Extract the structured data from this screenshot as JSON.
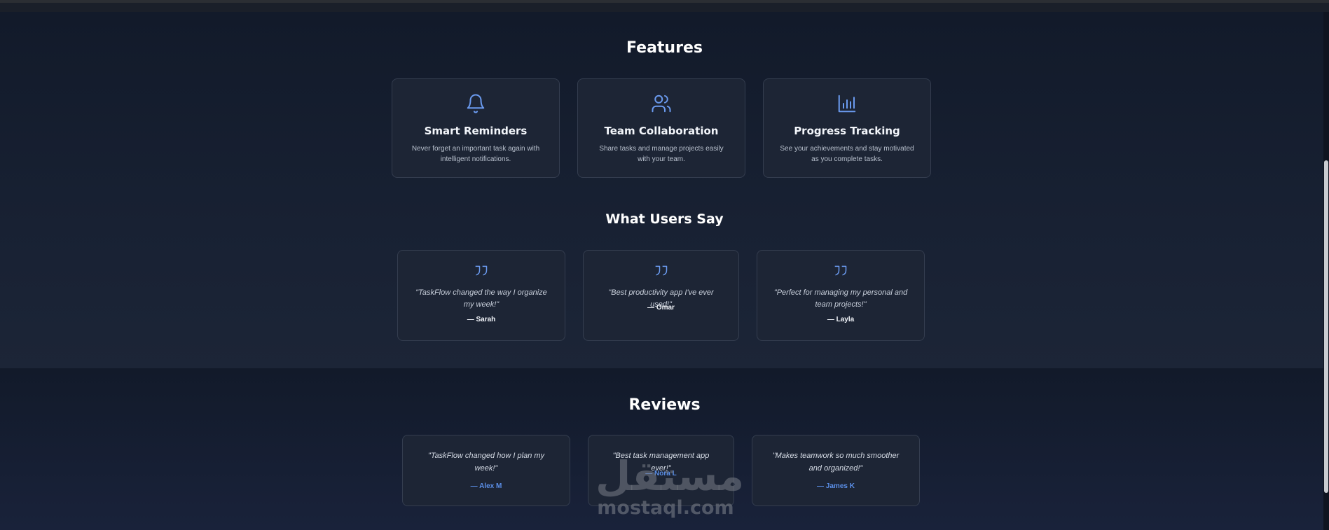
{
  "features": {
    "heading": "Features",
    "items": [
      {
        "icon": "bell-icon",
        "title": "Smart Reminders",
        "desc": "Never forget an important task again with intelligent notifications."
      },
      {
        "icon": "users-icon",
        "title": "Team Collaboration",
        "desc": "Share tasks and manage projects easily with your team."
      },
      {
        "icon": "bar-chart-icon",
        "title": "Progress Tracking",
        "desc": "See your achievements and stay motivated as you complete tasks."
      }
    ]
  },
  "testimonials": {
    "heading": "What Users Say",
    "items": [
      {
        "quote": "\"TaskFlow changed the way I organize my week!\"",
        "author": "— Sarah"
      },
      {
        "quote": "\"Best productivity app I've ever used!\"",
        "author": "— Omar"
      },
      {
        "quote": "\"Perfect for managing my personal and team projects!\"",
        "author": "— Layla"
      }
    ]
  },
  "reviews": {
    "heading": "Reviews",
    "items": [
      {
        "quote": "\"TaskFlow changed how I plan my week!\"",
        "author": "— Alex M"
      },
      {
        "quote": "\"Best task management app ever!\"",
        "author": "— Nora L"
      },
      {
        "quote": "\"Makes teamwork so much smoother and organized!\"",
        "author": "— James K"
      }
    ]
  },
  "watermark": {
    "arabic": "مستقل",
    "latin": "mostaql.com"
  },
  "colors": {
    "accent": "#6b9bf0",
    "background": "#141b2b",
    "card": "#1d2535"
  }
}
